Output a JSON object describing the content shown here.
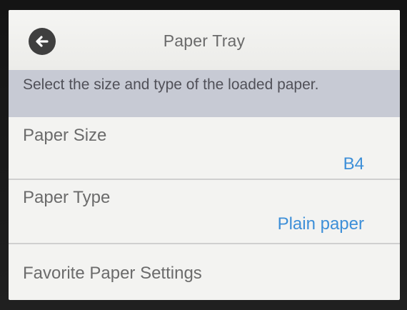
{
  "header": {
    "title": "Paper Tray",
    "back_icon": "arrow-left-icon"
  },
  "hint": {
    "text": "Select the size and type of the loaded paper."
  },
  "settings": [
    {
      "label": "Paper Size",
      "value": "B4"
    },
    {
      "label": "Paper Type",
      "value": "Plain paper"
    },
    {
      "label": "Favorite Paper Settings"
    }
  ],
  "colors": {
    "background": "#f3f3f1",
    "hint_bar": "#c7cad4",
    "value_text": "#3d8fd8",
    "label_text": "#6b6b6b",
    "back_button": "#3f3f3f"
  }
}
